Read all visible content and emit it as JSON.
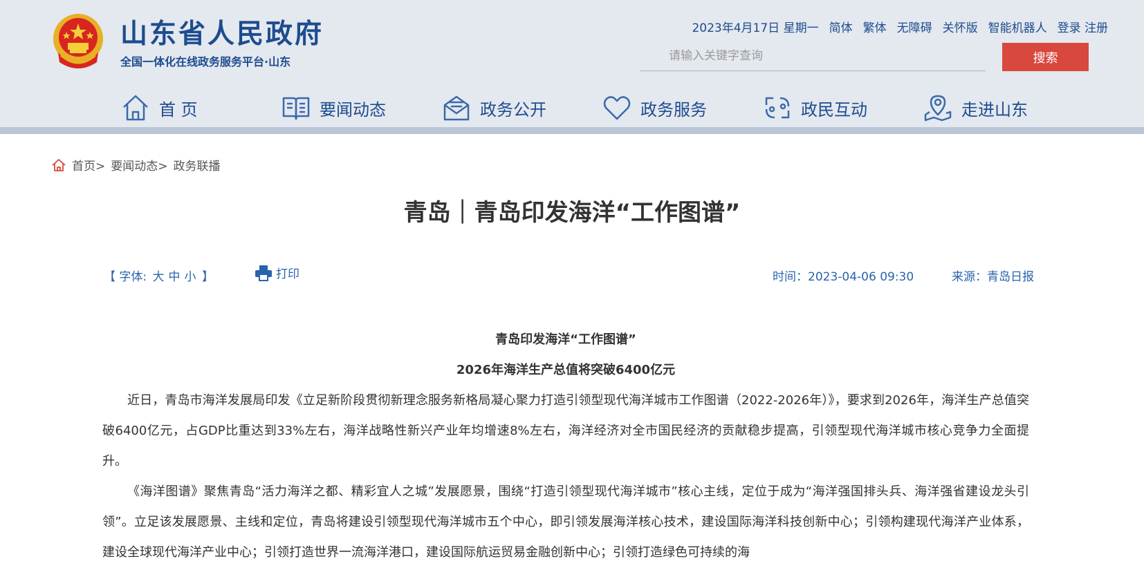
{
  "site": {
    "title": "山东省人民政府",
    "subtitle": "全国一体化在线政务服务平台·山东"
  },
  "toplinks": {
    "date": "2023年4月17日 星期一",
    "simplified": "简体",
    "traditional": "繁体",
    "accessibility": "无障碍",
    "care": "关怀版",
    "robot": "智能机器人",
    "login_register": "登录 注册"
  },
  "search": {
    "placeholder": "请输入关键字查询",
    "button": "搜索"
  },
  "nav": {
    "items": [
      {
        "label": "首 页",
        "icon": "home-icon"
      },
      {
        "label": "要闻动态",
        "icon": "book-icon"
      },
      {
        "label": "政务公开",
        "icon": "mail-icon"
      },
      {
        "label": "政务服务",
        "icon": "heart-icon"
      },
      {
        "label": "政民互动",
        "icon": "interaction-icon"
      },
      {
        "label": "走进山东",
        "icon": "map-pin-icon"
      }
    ]
  },
  "breadcrumb": {
    "items": [
      "首页>",
      "要闻动态>",
      "政务联播"
    ]
  },
  "article": {
    "title": "青岛｜青岛印发海洋“工作图谱”",
    "font_label": "【 字体:",
    "font_sizes": [
      "大",
      "中",
      "小"
    ],
    "font_end": "】",
    "print": "打印",
    "time": "时间：2023-04-06 09:30",
    "source": "来源：青岛日报",
    "heading1": "青岛印发海洋“工作图谱”",
    "heading2": "2026年海洋生产总值将突破6400亿元",
    "paragraphs": [
      "近日，青岛市海洋发展局印发《立足新阶段贯彻新理念服务新格局凝心聚力打造引领型现代海洋城市工作图谱（2022-2026年）》，要求到2026年，海洋生产总值突破6400亿元，占GDP比重达到33%左右，海洋战略性新兴产业年均增速8%左右，海洋经济对全市国民经济的贡献稳步提高，引领型现代海洋城市核心竞争力全面提升。",
      "《海洋图谱》聚焦青岛“活力海洋之都、精彩宜人之城”发展愿景，围绕“打造引领型现代海洋城市”核心主线，定位于成为“海洋强国排头兵、海洋强省建设龙头引领”。立足该发展愿景、主线和定位，青岛将建设引领型现代海洋城市五个中心，即引领发展海洋核心技术，建设国际海洋科技创新中心；引领构建现代海洋产业体系，建设全球现代海洋产业中心；引领打造世界一流海洋港口，建设国际航运贸易金融创新中心；引领打造绿色可持续的海"
    ]
  },
  "colors": {
    "brand_blue": "#1d4c8e",
    "search_red": "#d9483e",
    "header_bg": "#e4e8ef"
  }
}
